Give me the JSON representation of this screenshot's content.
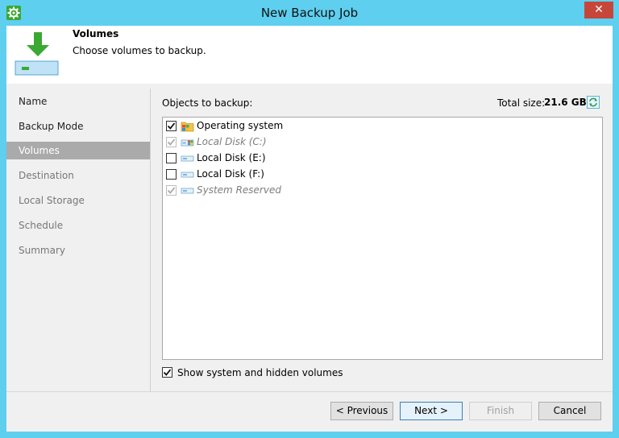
{
  "window": {
    "title": "New Backup Job",
    "close_glyph": "✕",
    "icon": "gear-icon"
  },
  "header": {
    "title": "Volumes",
    "subtitle": "Choose volumes to backup.",
    "icon": "download-disk-icon"
  },
  "sidebar": {
    "items": [
      {
        "label": "Name",
        "state": "normal"
      },
      {
        "label": "Backup Mode",
        "state": "normal"
      },
      {
        "label": "Volumes",
        "state": "active"
      },
      {
        "label": "Destination",
        "state": "disabled"
      },
      {
        "label": "Local Storage",
        "state": "disabled"
      },
      {
        "label": "Schedule",
        "state": "disabled"
      },
      {
        "label": "Summary",
        "state": "disabled"
      }
    ]
  },
  "main": {
    "objects_label": "Objects to backup:",
    "total_size_label": "Total size:",
    "total_size_value": "21.6 GB",
    "volumes": [
      {
        "label": "Operating system",
        "checked": true,
        "enabled": true,
        "icon": "windows-folder-icon"
      },
      {
        "label": "Local Disk (C:)",
        "checked": true,
        "enabled": false,
        "icon": "windows-disk-icon"
      },
      {
        "label": "Local Disk (E:)",
        "checked": false,
        "enabled": true,
        "icon": "disk-icon"
      },
      {
        "label": "Local Disk (F:)",
        "checked": false,
        "enabled": true,
        "icon": "disk-icon"
      },
      {
        "label": "System Reserved",
        "checked": true,
        "enabled": false,
        "icon": "disk-icon"
      }
    ],
    "show_hidden_label": "Show system and hidden volumes",
    "show_hidden_checked": true
  },
  "footer": {
    "previous": "< Previous",
    "next": "Next >",
    "finish": "Finish",
    "cancel": "Cancel"
  },
  "colors": {
    "frame": "#5ecfef",
    "active_nav": "#aaaaaa",
    "close": "#c7463a",
    "accent_green": "#3aa832"
  }
}
